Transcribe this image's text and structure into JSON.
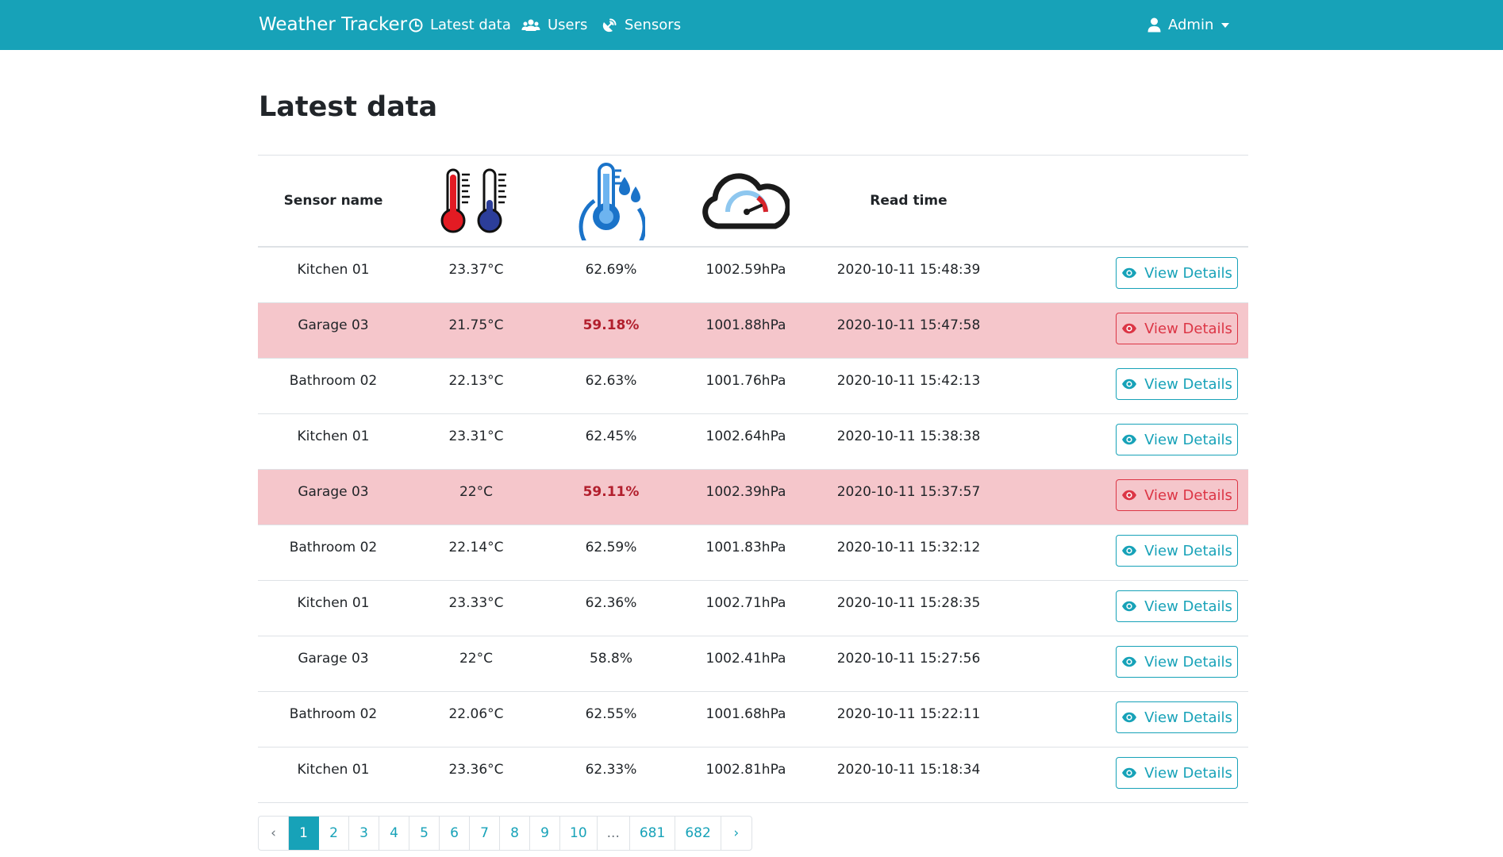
{
  "navbar": {
    "brand": "Weather Tracker",
    "items": [
      {
        "label": "Latest data",
        "icon": "clock-icon"
      },
      {
        "label": "Users",
        "icon": "users-icon"
      },
      {
        "label": "Sensors",
        "icon": "satellite-dish-icon"
      }
    ],
    "user": {
      "label": "Admin",
      "icon": "user-icon"
    }
  },
  "page": {
    "title": "Latest data"
  },
  "table": {
    "headers": {
      "sensor_name": "Sensor name",
      "temperature_icon": "thermometers-icon",
      "humidity_icon": "humidity-icon",
      "pressure_icon": "pressure-cloud-icon",
      "read_time": "Read time"
    },
    "button_label": "View Details",
    "rows": [
      {
        "sensor": "Kitchen 01",
        "temperature": "23.37°C",
        "humidity": "62.69%",
        "pressure": "1002.59hPa",
        "time": "2020-10-11 15:48:39",
        "alert": false
      },
      {
        "sensor": "Garage 03",
        "temperature": "21.75°C",
        "humidity": "59.18%",
        "pressure": "1001.88hPa",
        "time": "2020-10-11 15:47:58",
        "alert": true
      },
      {
        "sensor": "Bathroom 02",
        "temperature": "22.13°C",
        "humidity": "62.63%",
        "pressure": "1001.76hPa",
        "time": "2020-10-11 15:42:13",
        "alert": false
      },
      {
        "sensor": "Kitchen 01",
        "temperature": "23.31°C",
        "humidity": "62.45%",
        "pressure": "1002.64hPa",
        "time": "2020-10-11 15:38:38",
        "alert": false
      },
      {
        "sensor": "Garage 03",
        "temperature": "22°C",
        "humidity": "59.11%",
        "pressure": "1002.39hPa",
        "time": "2020-10-11 15:37:57",
        "alert": true
      },
      {
        "sensor": "Bathroom 02",
        "temperature": "22.14°C",
        "humidity": "62.59%",
        "pressure": "1001.83hPa",
        "time": "2020-10-11 15:32:12",
        "alert": false
      },
      {
        "sensor": "Kitchen 01",
        "temperature": "23.33°C",
        "humidity": "62.36%",
        "pressure": "1002.71hPa",
        "time": "2020-10-11 15:28:35",
        "alert": false
      },
      {
        "sensor": "Garage 03",
        "temperature": "22°C",
        "humidity": "58.8%",
        "pressure": "1002.41hPa",
        "time": "2020-10-11 15:27:56",
        "alert": false
      },
      {
        "sensor": "Bathroom 02",
        "temperature": "22.06°C",
        "humidity": "62.55%",
        "pressure": "1001.68hPa",
        "time": "2020-10-11 15:22:11",
        "alert": false
      },
      {
        "sensor": "Kitchen 01",
        "temperature": "23.36°C",
        "humidity": "62.33%",
        "pressure": "1002.81hPa",
        "time": "2020-10-11 15:18:34",
        "alert": false
      }
    ]
  },
  "pagination": {
    "prev": "‹",
    "next": "›",
    "pages": [
      "1",
      "2",
      "3",
      "4",
      "5",
      "6",
      "7",
      "8",
      "9",
      "10",
      "...",
      "681",
      "682"
    ],
    "active": "1"
  },
  "colors": {
    "primary": "#17a2b8",
    "danger_row": "#f5c6cb",
    "danger_text": "#b21f2d",
    "danger_button": "#dc3545"
  }
}
